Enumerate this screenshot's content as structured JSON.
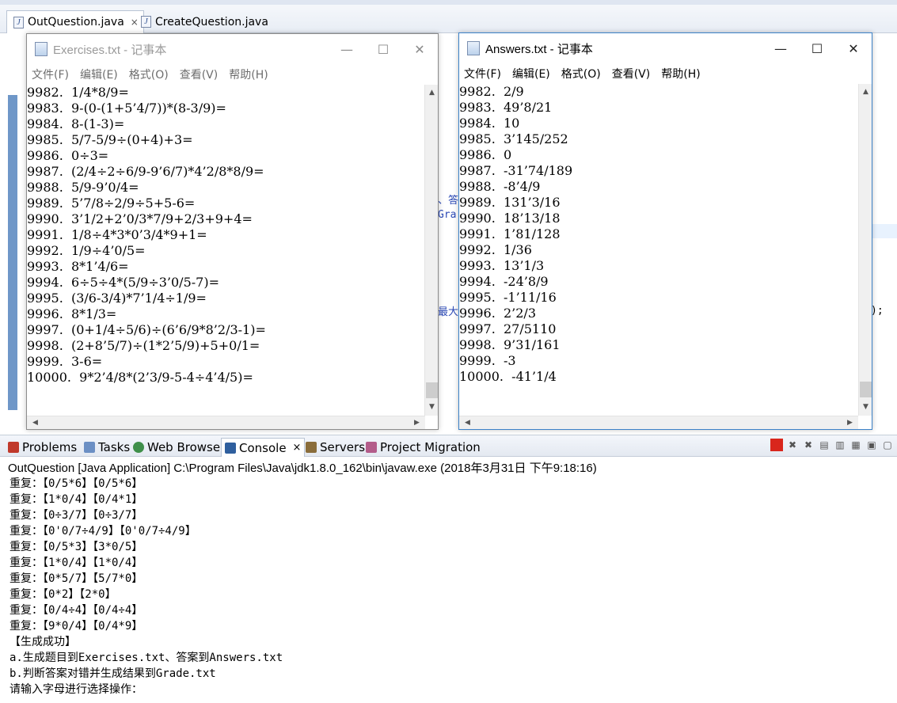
{
  "editor": {
    "tabs": [
      {
        "label": "OutQuestion.java",
        "close": "×",
        "active": true
      },
      {
        "label": "CreateQuestion.java",
        "active": false
      }
    ],
    "background_fragments": [
      "、答",
      "Gra",
      "最大",
      ");"
    ]
  },
  "exercises_window": {
    "title": "Exercises.txt - 记事本",
    "menu": [
      "文件(F)",
      "编辑(E)",
      "格式(O)",
      "查看(V)",
      "帮助(H)"
    ],
    "window_buttons": {
      "minimize": "—",
      "maximize": "☐",
      "close": "✕"
    },
    "lines": [
      "9982.  1/4*8/9=",
      "9983.  9-(0-(1+5’4/7))*(8-3/9)=",
      "9984.  8-(1-3)=",
      "9985.  5/7-5/9÷(0+4)+3=",
      "9986.  0÷3=",
      "9987.  (2/4÷2÷6/9-9’6/7)*4’2/8*8/9=",
      "9988.  5/9-9’0/4=",
      "9989.  5’7/8÷2/9÷5+5-6=",
      "9990.  3’1/2+2’0/3*7/9+2/3+9+4=",
      "9991.  1/8÷4*3*0’3/4*9+1=",
      "9992.  1/9÷4’0/5=",
      "9993.  8*1’4/6=",
      "9994.  6÷5÷4*(5/9÷3’0/5-7)=",
      "9995.  (3/6-3/4)*7’1/4÷1/9=",
      "9996.  8*1/3=",
      "9997.  (0+1/4÷5/6)÷(6’6/9*8’2/3-1)=",
      "9998.  (2+8’5/7)÷(1*2’5/9)+5+0/1=",
      "9999.  3-6=",
      "10000.  9*2’4/8*(2’3/9-5-4÷4’4/5)="
    ]
  },
  "answers_window": {
    "title": "Answers.txt - 记事本",
    "menu": [
      "文件(F)",
      "编辑(E)",
      "格式(O)",
      "查看(V)",
      "帮助(H)"
    ],
    "window_buttons": {
      "minimize": "—",
      "maximize": "☐",
      "close": "✕"
    },
    "lines": [
      "9982.  2/9",
      "9983.  49’8/21",
      "9984.  10",
      "9985.  3’145/252",
      "9986.  0",
      "9987.  -31’74/189",
      "9988.  -8’4/9",
      "9989.  131’3/16",
      "9990.  18’13/18",
      "9991.  1’81/128",
      "9992.  1/36",
      "9993.  13’1/3",
      "9994.  -24’8/9",
      "9995.  -1’11/16",
      "9996.  2’2/3",
      "9997.  27/5110",
      "9998.  9’31/161",
      "9999.  -3",
      "10000.  -41’1/4"
    ]
  },
  "console": {
    "tabs": [
      "Problems",
      "Tasks",
      "Web Browser",
      "Console",
      "Servers",
      "Project Migration"
    ],
    "console_close": "×",
    "header": "OutQuestion [Java Application] C:\\Program Files\\Java\\jdk1.8.0_162\\bin\\javaw.exe (2018年3月31日 下午9:18:16)",
    "lines": [
      "重复：【0/5*6】【0/5*6】",
      "重复：【1*0/4】【0/4*1】",
      "重复：【0÷3/7】【0÷3/7】",
      "重复：【0'0/7÷4/9】【0'0/7÷4/9】",
      "重复：【0/5*3】【3*0/5】",
      "重复：【1*0/4】【1*0/4】",
      "重复：【0*5/7】【5/7*0】",
      "重复：【0*2】【2*0】",
      "重复：【0/4÷4】【0/4÷4】",
      "重复：【9*0/4】【0/4*9】",
      "【生成成功】",
      "a.生成题目到Exercises.txt、答案到Answers.txt",
      "b.判断答案对错并生成结果到Grade.txt",
      "请输入字母进行选择操作："
    ]
  },
  "colors": {
    "accent": "#2a48b5",
    "terminate": "#d9261c"
  }
}
